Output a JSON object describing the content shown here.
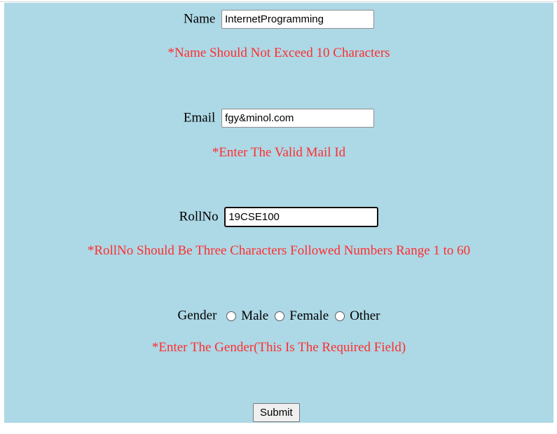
{
  "form": {
    "name": {
      "label": "Name",
      "value": "InternetProgramming",
      "error": "*Name Should Not Exceed 10 Characters"
    },
    "email": {
      "label": "Email",
      "value": "fgy&minol.com",
      "error": "*Enter The Valid Mail Id"
    },
    "rollno": {
      "label": "RollNo",
      "value": "19CSE100",
      "error": "*RollNo Should Be Three Characters Followed Numbers Range 1 to 60"
    },
    "gender": {
      "label": "Gender",
      "options": [
        "Male",
        "Female",
        "Other"
      ],
      "error": "*Enter The Gender(This Is The Required Field)"
    },
    "submit_label": "Submit"
  },
  "colors": {
    "panel_background": "#add8e6",
    "error_text": "#ff2e2e"
  }
}
